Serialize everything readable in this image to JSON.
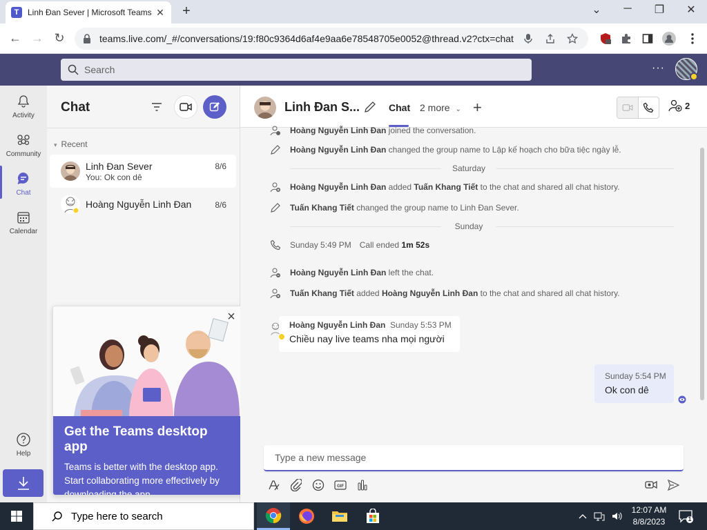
{
  "browser": {
    "tab_title": "Linh Đan Sever | Microsoft Teams",
    "tab_favicon": "T",
    "new_tab": "+",
    "url": "teams.live.com/_#/conversations/19:f80c9364d6af4e9aa6e78548705e0052@thread.v2?ctx=chat",
    "window_controls": {
      "tab_list": "⌄",
      "minimize": "─",
      "maximize": "❐",
      "close": "✕"
    }
  },
  "teams_header": {
    "search_placeholder": "Search",
    "more": "···"
  },
  "rail": [
    {
      "label": "Activity",
      "icon": "bell-icon"
    },
    {
      "label": "Community",
      "icon": "community-icon"
    },
    {
      "label": "Chat",
      "icon": "chat-icon",
      "active": true
    },
    {
      "label": "Calendar",
      "icon": "calendar-icon"
    },
    {
      "label": "Help",
      "icon": "help-icon"
    }
  ],
  "chat_list": {
    "title": "Chat",
    "section": "Recent",
    "items": [
      {
        "name": "Linh Đan Sever",
        "preview": "You: Ok con dê",
        "date": "8/6",
        "selected": true
      },
      {
        "name": "Hoàng Nguyễn Linh Đan",
        "preview": "",
        "date": "8/6",
        "selected": false
      }
    ]
  },
  "promo": {
    "close": "×",
    "title": "Get the Teams desktop app",
    "body": "Teams is better with the desktop app. Start collaborating more effectively by downloading the app."
  },
  "conversation": {
    "title": "Linh Đan S...",
    "tab_chat": "Chat",
    "tab_more": "2 more",
    "tab_add": "+",
    "participants_count": "2",
    "events": [
      {
        "type": "join",
        "actor": "Hoàng Nguyễn Linh Đan",
        "text": " joined the conversation."
      },
      {
        "type": "rename",
        "actor": "Hoàng Nguyễn Linh Đan",
        "text": " changed the group name to Lập kế hoạch cho bữa tiệc ngày lễ."
      },
      {
        "type": "day",
        "text": "Saturday"
      },
      {
        "type": "add",
        "actor": "Hoàng Nguyễn Linh Đan",
        "text": " added ",
        "target": "Tuấn Khang Tiết",
        "text2": " to the chat and shared all chat history."
      },
      {
        "type": "rename",
        "actor": "Tuấn Khang Tiết",
        "text": " changed the group name to Linh Đan Sever."
      },
      {
        "type": "day",
        "text": "Sunday"
      },
      {
        "type": "call",
        "time": "Sunday 5:49 PM",
        "text": "Call ended ",
        "duration": "1m 52s"
      },
      {
        "type": "leave",
        "actor": "Hoàng Nguyễn Linh Đan",
        "text": " left the chat."
      },
      {
        "type": "add",
        "actor": "Tuấn Khang Tiết",
        "text": " added ",
        "target": "Hoàng Nguyễn Linh Đan",
        "text2": " to the chat and shared all chat history."
      }
    ],
    "message_in": {
      "sender": "Hoàng Nguyễn Linh Đan",
      "time": "Sunday 5:53 PM",
      "text": "Chiều nay live teams nha mọi người"
    },
    "message_out": {
      "time": "Sunday 5:54 PM",
      "text": "Ok con dê"
    },
    "compose_placeholder": "Type a new message"
  },
  "taskbar": {
    "search_placeholder": "Type here to search",
    "time": "12:07 AM",
    "date": "8/8/2023",
    "notification_count": "1"
  },
  "colors": {
    "teams_header": "#464775",
    "accent": "#5b5fc7",
    "taskbar": "#1f2a36"
  }
}
